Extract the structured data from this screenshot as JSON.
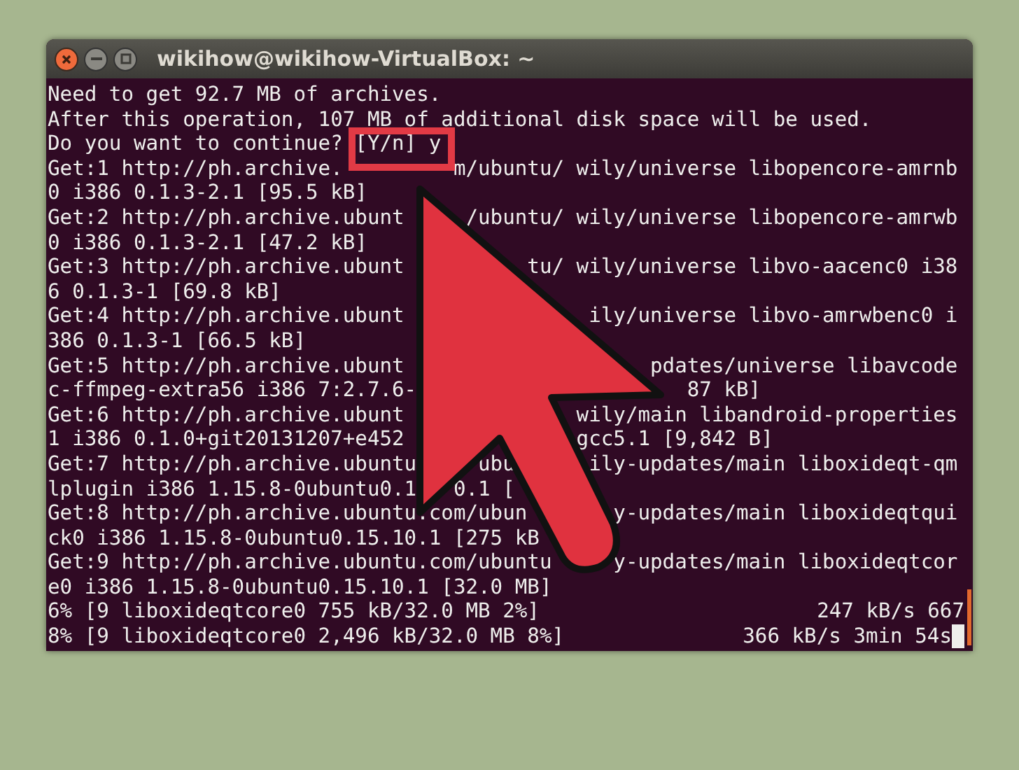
{
  "window": {
    "title": "wikihow@wikihow-VirtualBox: ~"
  },
  "terminal": {
    "lines": [
      {
        "kind": "text",
        "text": "Need to get 92.7 MB of archives."
      },
      {
        "kind": "text",
        "text": "After this operation, 107 MB of additional disk space will be used."
      },
      {
        "kind": "prompt",
        "text": "Do you want to continue? ",
        "answer": "[Y/n] y"
      },
      {
        "kind": "text",
        "text": "Get:1 http://ph.archive.         m/ubuntu/ wily/universe libopencore-amrnb"
      },
      {
        "kind": "text",
        "text": "0 i386 0.1.3-2.1 [95.5 kB]"
      },
      {
        "kind": "text",
        "text": "Get:2 http://ph.archive.ubunt     /ubuntu/ wily/universe libopencore-amrwb"
      },
      {
        "kind": "text",
        "text": "0 i386 0.1.3-2.1 [47.2 kB]"
      },
      {
        "kind": "text",
        "text": "Get:3 http://ph.archive.ubunt          tu/ wily/universe libvo-aacenc0 i38"
      },
      {
        "kind": "text",
        "text": "6 0.1.3-1 [69.8 kB]"
      },
      {
        "kind": "text",
        "text": "Get:4 http://ph.archive.ubunt               ily/universe libvo-amrwbenc0 i"
      },
      {
        "kind": "text",
        "text": "386 0.1.3-1 [66.5 kB]"
      },
      {
        "kind": "text",
        "text": "Get:5 http://ph.archive.ubunt                    pdates/universe libavcode"
      },
      {
        "kind": "text",
        "text": "c-ffmpeg-extra56 i386 7:2.7.6-                      87 kB]"
      },
      {
        "kind": "text",
        "text": "Get:6 http://ph.archive.ubunt              wily/main libandroid-properties"
      },
      {
        "kind": "text",
        "text": "1 i386 0.1.0+git20131207+e452              gcc5.1 [9,842 B]"
      },
      {
        "kind": "text",
        "text": "Get:7 http://ph.archive.ubuntu     ubu      ily-updates/main liboxideqt-qm"
      },
      {
        "kind": "text",
        "text": "lplugin i386 1.15.8-0ubuntu0.1   0.1 ["
      },
      {
        "kind": "text",
        "text": "Get:8 http://ph.archive.ubuntu.com/ubun       y-updates/main liboxideqtqui"
      },
      {
        "kind": "text",
        "text": "ck0 i386 1.15.8-0ubuntu0.15.10.1 [275 kB"
      },
      {
        "kind": "text",
        "text": "Get:9 http://ph.archive.ubuntu.com/ubuntu     y-updates/main liboxideqtcor"
      },
      {
        "kind": "text",
        "text": "e0 i386 1.15.8-0ubuntu0.15.10.1 [32.0 MB]"
      },
      {
        "kind": "progress",
        "text": "6% [9 liboxideqtcore0 755 kB/32.0 MB 2%]",
        "right": "247 kB/s 667",
        "cursor": false
      },
      {
        "kind": "progress",
        "text": "8% [9 liboxideqtcore0 2,496 kB/32.0 MB 8%]",
        "right": "366 kB/s 3min 54s",
        "cursor": true
      }
    ]
  }
}
